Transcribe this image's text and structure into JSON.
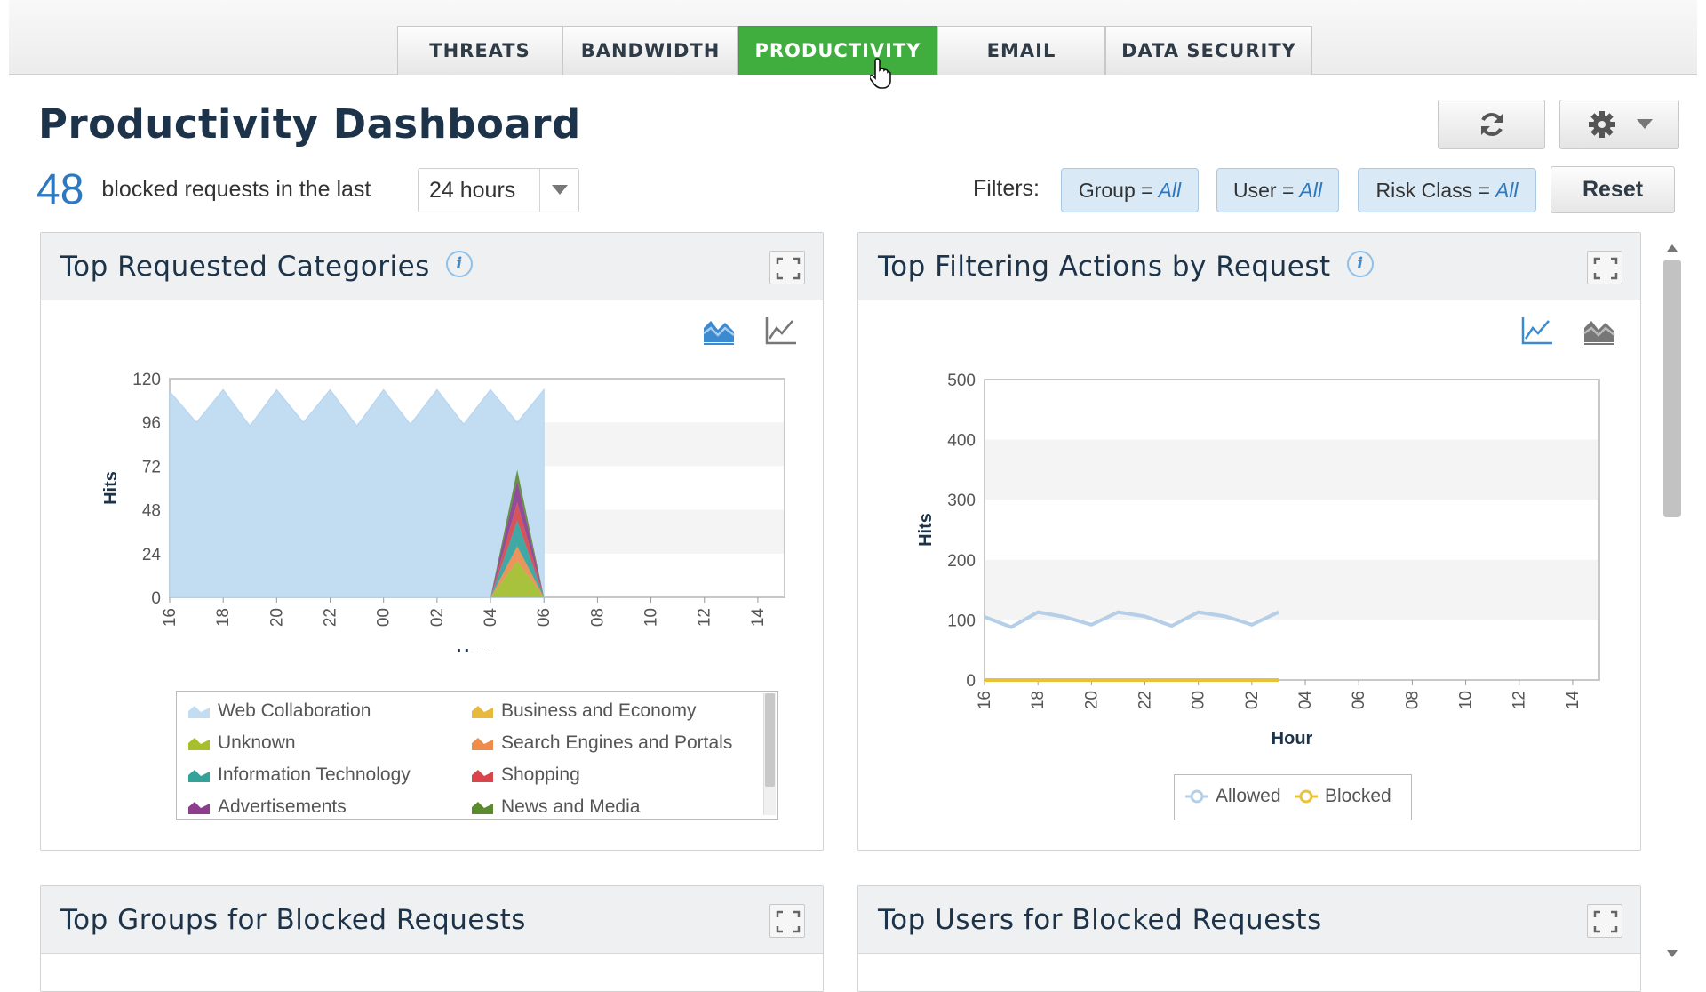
{
  "tabs": [
    {
      "label": "THREATS",
      "active": false
    },
    {
      "label": "BANDWIDTH",
      "active": false
    },
    {
      "label": "PRODUCTIVITY",
      "active": true
    },
    {
      "label": "EMAIL",
      "active": false
    },
    {
      "label": "DATA SECURITY",
      "active": false
    }
  ],
  "page": {
    "title": "Productivity Dashboard",
    "blocked_count": "48",
    "summary_text": "blocked requests in the last",
    "time_range": "24 hours",
    "filters_label": "Filters:",
    "filters": [
      {
        "name": "Group =",
        "value": "All"
      },
      {
        "name": "User =",
        "value": "All"
      },
      {
        "name": "Risk Class =",
        "value": "All"
      }
    ],
    "reset_label": "Reset"
  },
  "icons": {
    "refresh": "refresh-icon",
    "settings": "gear-icon",
    "dropdown": "chevron-down-icon",
    "info": "info-icon",
    "expand": "expand-icon",
    "area_chart": "area-chart-icon",
    "line_chart": "line-chart-icon"
  },
  "colors": {
    "active_tab": "#3fae3f",
    "title": "#1d3349",
    "accent_blue": "#2e79be",
    "chip_bg": "#d9e9f6"
  },
  "panels": {
    "categories": {
      "title": "Top Requested Categories",
      "info": "i"
    },
    "actions": {
      "title": "Top Filtering Actions by Request",
      "info": "i"
    },
    "groups": {
      "title": "Top Groups for Blocked Requests"
    },
    "users": {
      "title": "Top Users for Blocked Requests"
    }
  },
  "chart_data": [
    {
      "type": "area",
      "stacked": true,
      "ylabel": "Hits",
      "xlabel": "Hour",
      "ylim": [
        0,
        120
      ],
      "yticks": [
        0,
        24,
        48,
        72,
        96,
        120
      ],
      "x": [
        "16",
        "17",
        "18",
        "19",
        "20",
        "21",
        "22",
        "23",
        "00",
        "01",
        "02",
        "03",
        "04",
        "05",
        "06",
        "07",
        "08",
        "09",
        "10",
        "11",
        "12",
        "13",
        "14",
        "15"
      ],
      "xticks": [
        "16",
        "18",
        "20",
        "22",
        "00",
        "02",
        "04",
        "06",
        "08",
        "10",
        "12",
        "14"
      ],
      "series": [
        {
          "name": "Web Collaboration",
          "color": "#c2dcf2",
          "values": [
            113,
            96,
            114,
            94,
            114,
            96,
            114,
            94,
            114,
            95,
            114,
            95,
            114,
            96,
            114,
            null,
            null,
            null,
            null,
            null,
            null,
            null,
            null,
            null
          ]
        },
        {
          "name": "Business and Economy",
          "color": "#e8b93d",
          "values": [
            0,
            0,
            0,
            0,
            0,
            0,
            0,
            0,
            0,
            0,
            0,
            0,
            0,
            0,
            0,
            0,
            null,
            null,
            null,
            null,
            null,
            null,
            null,
            null
          ]
        },
        {
          "name": "Unknown",
          "color": "#a6bf2a",
          "values": [
            0,
            0,
            0,
            0,
            0,
            0,
            0,
            0,
            0,
            0,
            0,
            0,
            0,
            20,
            0,
            0,
            null,
            null,
            null,
            null,
            null,
            null,
            null,
            null
          ]
        },
        {
          "name": "Search Engines and Portals",
          "color": "#ef8c4a",
          "values": [
            0,
            0,
            0,
            0,
            0,
            0,
            0,
            0,
            0,
            0,
            0,
            0,
            0,
            8,
            0,
            0,
            null,
            null,
            null,
            null,
            null,
            null,
            null,
            null
          ]
        },
        {
          "name": "Information Technology",
          "color": "#33a39a",
          "values": [
            0,
            0,
            0,
            0,
            0,
            0,
            0,
            0,
            0,
            0,
            0,
            0,
            0,
            14,
            0,
            0,
            null,
            null,
            null,
            null,
            null,
            null,
            null,
            null
          ]
        },
        {
          "name": "Shopping",
          "color": "#d9454a",
          "values": [
            0,
            0,
            0,
            0,
            0,
            0,
            0,
            0,
            0,
            0,
            0,
            0,
            0,
            10,
            0,
            0,
            null,
            null,
            null,
            null,
            null,
            null,
            null,
            null
          ]
        },
        {
          "name": "Advertisements",
          "color": "#8e3d8e",
          "values": [
            0,
            0,
            0,
            0,
            0,
            0,
            0,
            0,
            0,
            0,
            0,
            0,
            0,
            12,
            0,
            0,
            null,
            null,
            null,
            null,
            null,
            null,
            null,
            null
          ]
        },
        {
          "name": "News and Media",
          "color": "#5c8a2e",
          "values": [
            0,
            0,
            0,
            0,
            0,
            0,
            0,
            0,
            0,
            0,
            0,
            0,
            0,
            6,
            0,
            0,
            null,
            null,
            null,
            null,
            null,
            null,
            null,
            null
          ]
        }
      ],
      "legend_placement": "bottom"
    },
    {
      "type": "line",
      "ylabel": "Hits",
      "xlabel": "Hour",
      "ylim": [
        0,
        500
      ],
      "yticks": [
        0,
        100,
        200,
        300,
        400,
        500
      ],
      "x": [
        "16",
        "17",
        "18",
        "19",
        "20",
        "21",
        "22",
        "23",
        "00",
        "01",
        "02",
        "03",
        "04",
        "05",
        "06",
        "07",
        "08",
        "09",
        "10",
        "11",
        "12",
        "13",
        "14",
        "15"
      ],
      "xticks": [
        "16",
        "18",
        "20",
        "22",
        "00",
        "02",
        "04",
        "06",
        "08",
        "10",
        "12",
        "14"
      ],
      "series": [
        {
          "name": "Allowed",
          "color": "#b4cfe7",
          "values": [
            105,
            88,
            113,
            105,
            92,
            113,
            106,
            90,
            113,
            106,
            92,
            113,
            null,
            null,
            null,
            null,
            null,
            null,
            null,
            null,
            null,
            null,
            null,
            null
          ]
        },
        {
          "name": "Blocked",
          "color": "#e8c33a",
          "values": [
            0,
            0,
            0,
            0,
            0,
            0,
            0,
            0,
            0,
            0,
            0,
            0,
            null,
            null,
            null,
            null,
            null,
            null,
            null,
            null,
            null,
            null,
            null,
            null
          ]
        }
      ],
      "legend_placement": "bottom"
    }
  ]
}
